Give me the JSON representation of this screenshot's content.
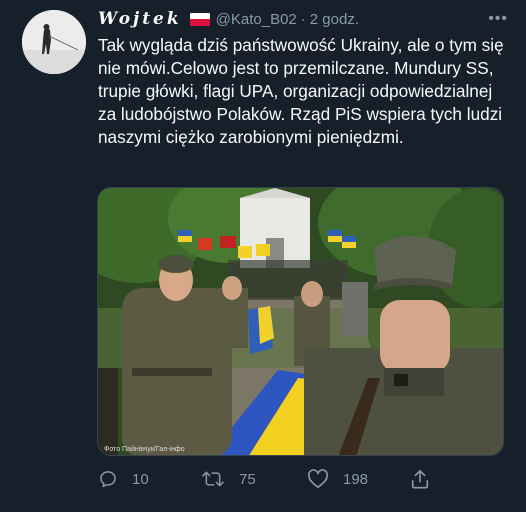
{
  "tweet": {
    "display_name": "Wojtek",
    "flag_icon": "poland-flag-icon",
    "handle": "@Kato_B02",
    "separator": "·",
    "time": "2 godz.",
    "more_label": "•••",
    "text": "Tak wygląda dziś państwowość Ukrainy, ale o tym się nie mówi.Celowo jest to przemilczane. Mundury SS, trupie główki, flagi UPA, organizacji odpowiedzialnej za ludobójstwo Polaków. Rząd PiS wspiera tych ludzi naszymi ciężko zarobionymi pieniędzmi.",
    "photo_credit": "Фото Пайнівчук/Гал-інфо",
    "actions": {
      "reply_count": "10",
      "retweet_count": "75",
      "like_count": "198"
    }
  },
  "colors": {
    "background": "#15202b",
    "secondary_text": "#8b98a5",
    "primary_text": "#f7f9f9",
    "border": "#38444d"
  }
}
